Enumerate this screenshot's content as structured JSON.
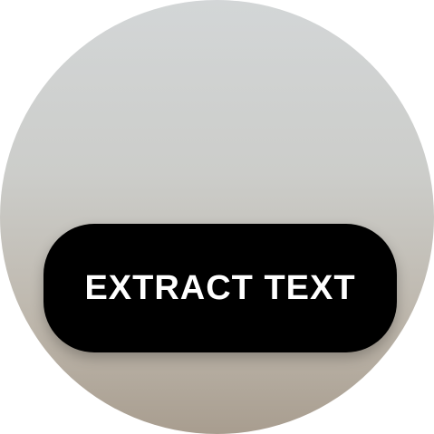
{
  "screen": {
    "action_button": {
      "label": "EXTRACT TEXT"
    }
  },
  "colors": {
    "button_background": "#000000",
    "button_text": "#ffffff",
    "background_top": "#d3d6d7",
    "background_bottom": "#a89d8f"
  }
}
